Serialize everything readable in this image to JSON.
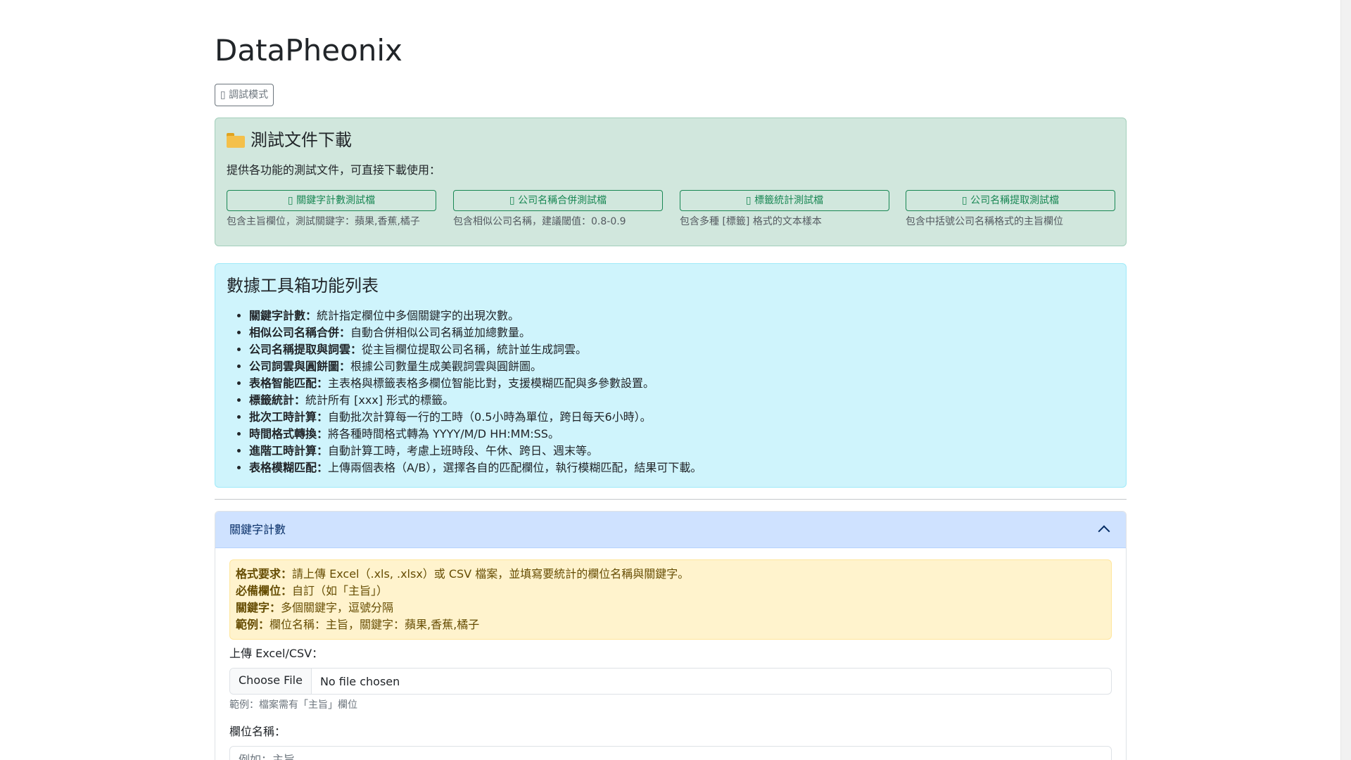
{
  "page": {
    "title": "DataPheonix",
    "debug_button": "調試模式"
  },
  "test_files": {
    "heading": "測試文件下載",
    "description": "提供各功能的測試文件，可直接下載使用：",
    "items": [
      {
        "label": "關鍵字計數測試檔",
        "note": "包含主旨欄位，測試關鍵字：蘋果,香蕉,橘子"
      },
      {
        "label": "公司名稱合併測試檔",
        "note": "包含相似公司名稱，建議閾值：0.8-0.9"
      },
      {
        "label": "標籤統計測試檔",
        "note": "包含多種 [標籤] 格式的文本樣本"
      },
      {
        "label": "公司名稱提取測試檔",
        "note": "包含中括號公司名稱格式的主旨欄位"
      }
    ]
  },
  "features": {
    "heading": "數據工具箱功能列表",
    "items": [
      {
        "name": "關鍵字計數：",
        "desc": "統計指定欄位中多個關鍵字的出現次數。"
      },
      {
        "name": "相似公司名稱合併：",
        "desc": "自動合併相似公司名稱並加總數量。"
      },
      {
        "name": "公司名稱提取與詞雲：",
        "desc": "從主旨欄位提取公司名稱，統計並生成詞雲。"
      },
      {
        "name": "公司詞雲與圓餅圖：",
        "desc": "根據公司數量生成美觀詞雲與圓餅圖。"
      },
      {
        "name": "表格智能匹配：",
        "desc": "主表格與標籤表格多欄位智能比對，支援模糊匹配與多參數設置。"
      },
      {
        "name": "標籤統計：",
        "desc": "統計所有 [xxx] 形式的標籤。"
      },
      {
        "name": "批次工時計算：",
        "desc": "自動批次計算每一行的工時（0.5小時為單位，跨日每天6小時）。"
      },
      {
        "name": "時間格式轉換：",
        "desc": "將各種時間格式轉為 YYYY/M/D HH:MM:SS。"
      },
      {
        "name": "進階工時計算：",
        "desc": "自動計算工時，考慮上班時段、午休、跨日、週末等。"
      },
      {
        "name": "表格模糊匹配：",
        "desc": "上傳兩個表格（A/B），選擇各自的匹配欄位，執行模糊匹配，結果可下載。"
      }
    ]
  },
  "accordion": {
    "header": "關鍵字計數",
    "alert": [
      {
        "label": "格式要求：",
        "text": "請上傳 Excel（.xls, .xlsx）或 CSV 檔案，並填寫要統計的欄位名稱與關鍵字。"
      },
      {
        "label": "必備欄位：",
        "text": "自訂（如「主旨」）"
      },
      {
        "label": "關鍵字：",
        "text": "多個關鍵字，逗號分隔"
      },
      {
        "label": "範例：",
        "text": "欄位名稱：主旨，關鍵字：蘋果,香蕉,橘子"
      }
    ],
    "upload_label": "上傳 Excel/CSV：",
    "file_button": "Choose File",
    "file_status": "No file chosen",
    "upload_hint": "範例：檔案需有「主旨」欄位",
    "column_label": "欄位名稱：",
    "column_placeholder": "例如：主旨"
  }
}
